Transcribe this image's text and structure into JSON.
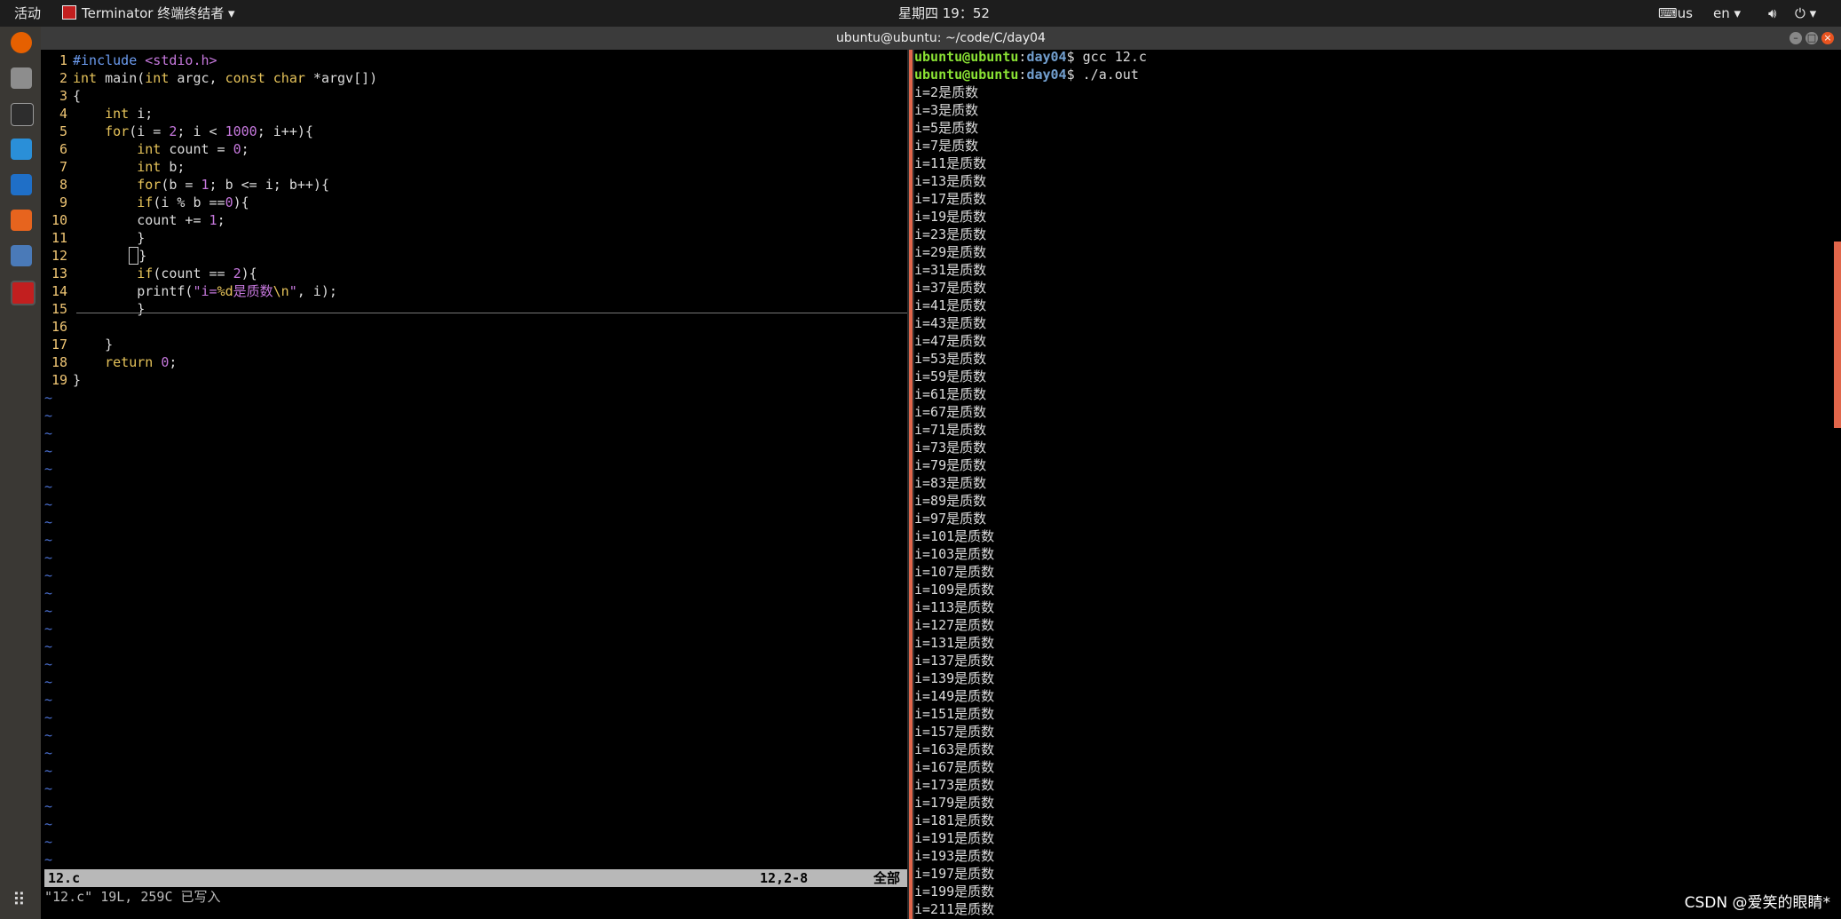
{
  "topbar": {
    "activities": "活动",
    "app_name": "Terminator 终端终结者",
    "clock": "星期四 19：52",
    "keyboard": "us",
    "language": "en"
  },
  "window": {
    "title": "ubuntu@ubuntu: ~/code/C/day04"
  },
  "dock": {
    "items": [
      "firefox-icon",
      "files-icon",
      "terminal-icon",
      "vscode-icon",
      "vc-icon",
      "software-icon",
      "settings-icon",
      "terminator-icon"
    ]
  },
  "editor": {
    "lines": [
      {
        "n": "1",
        "html": "<span class=\"pre\">#include</span> <span class=\"str\">&lt;stdio.h&gt;</span>"
      },
      {
        "n": "2",
        "html": "<span class=\"kw\">int</span> main(<span class=\"kw\">int</span> argc, <span class=\"kw\">const</span> <span class=\"kw\">char</span> *argv[])"
      },
      {
        "n": "3",
        "html": "{"
      },
      {
        "n": "4",
        "html": "    <span class=\"kw\">int</span> i;"
      },
      {
        "n": "5",
        "html": "    <span class=\"kw\">for</span>(i = <span class=\"num\">2</span>; i &lt; <span class=\"num\">1000</span>; i++){"
      },
      {
        "n": "6",
        "html": "        <span class=\"kw\">int</span> count = <span class=\"num\">0</span>;"
      },
      {
        "n": "7",
        "html": "        <span class=\"kw\">int</span> b;"
      },
      {
        "n": "8",
        "html": "        <span class=\"kw\">for</span>(b = <span class=\"num\">1</span>; b &lt;= i; b++){"
      },
      {
        "n": "9",
        "html": "        <span class=\"kw\">if</span>(i % b ==<span class=\"num\">0</span>){"
      },
      {
        "n": "10",
        "html": "        count += <span class=\"num\">1</span>;"
      },
      {
        "n": "11",
        "html": "        }"
      },
      {
        "n": "12",
        "html": "       <span class=\"cur\"> </span>}"
      },
      {
        "n": "13",
        "html": "        <span class=\"kw\">if</span>(count == <span class=\"num\">2</span>){"
      },
      {
        "n": "14",
        "html": "        printf(<span class=\"str\">\"i=</span><span class=\"kw\">%d</span><span class=\"str\">是质数</span><span class=\"kw\">\\n</span><span class=\"str\">\"</span>, i);"
      },
      {
        "n": "15",
        "html": "        }"
      },
      {
        "n": "16",
        "html": ""
      },
      {
        "n": "17",
        "html": "    }"
      },
      {
        "n": "18",
        "html": "    <span class=\"kw\">return</span> <span class=\"num\">0</span>;"
      },
      {
        "n": "19",
        "html": "}"
      }
    ],
    "tilde_count": 27,
    "status": {
      "filename": "12.c",
      "position": "12,2-8",
      "scroll": "全部"
    },
    "message": "\"12.c\" 19L, 259C 已写入"
  },
  "terminal": {
    "prompt_user": "ubuntu@ubuntu",
    "prompt_path": "day04",
    "commands": [
      "gcc 12.c",
      "./a.out"
    ],
    "output": [
      "i=2是质数",
      "i=3是质数",
      "i=5是质数",
      "i=7是质数",
      "i=11是质数",
      "i=13是质数",
      "i=17是质数",
      "i=19是质数",
      "i=23是质数",
      "i=29是质数",
      "i=31是质数",
      "i=37是质数",
      "i=41是质数",
      "i=43是质数",
      "i=47是质数",
      "i=53是质数",
      "i=59是质数",
      "i=61是质数",
      "i=67是质数",
      "i=71是质数",
      "i=73是质数",
      "i=79是质数",
      "i=83是质数",
      "i=89是质数",
      "i=97是质数",
      "i=101是质数",
      "i=103是质数",
      "i=107是质数",
      "i=109是质数",
      "i=113是质数",
      "i=127是质数",
      "i=131是质数",
      "i=137是质数",
      "i=139是质数",
      "i=149是质数",
      "i=151是质数",
      "i=157是质数",
      "i=163是质数",
      "i=167是质数",
      "i=173是质数",
      "i=179是质数",
      "i=181是质数",
      "i=191是质数",
      "i=193是质数",
      "i=197是质数",
      "i=199是质数",
      "i=211是质数"
    ]
  },
  "watermark": "CSDN @爱笑的眼睛*",
  "colors": {
    "accent": "#e1664b",
    "prompt_user": "#8ae234",
    "prompt_path": "#729fcf"
  }
}
